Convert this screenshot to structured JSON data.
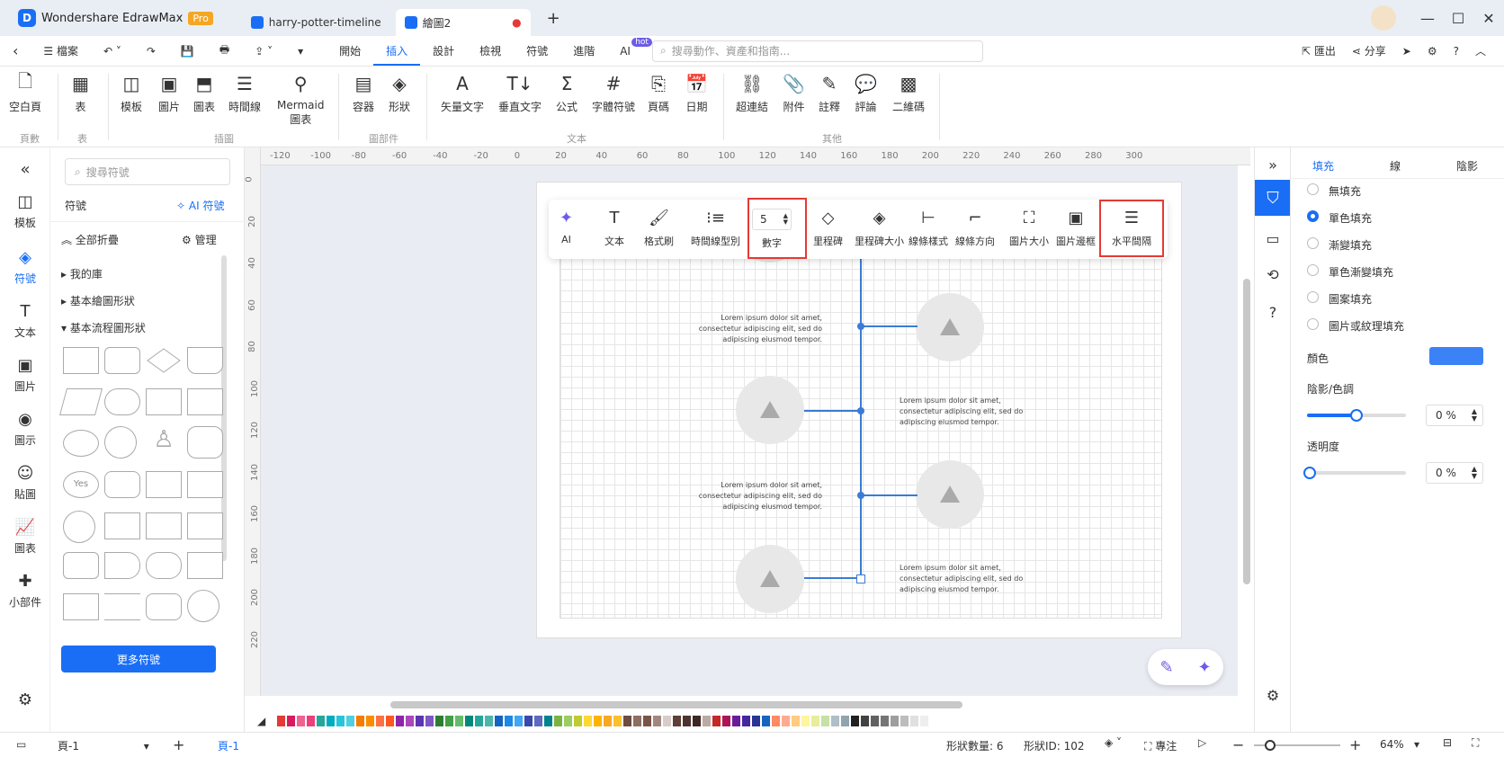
{
  "titlebar": {
    "app_name": "Wondershare EdrawMax",
    "pro_badge": "Pro",
    "tabs": [
      {
        "label": "harry-potter-timeline"
      },
      {
        "label": "繪圖2"
      }
    ],
    "new_tab": "+"
  },
  "menu": {
    "back": "‹",
    "file": "☰ 檔案",
    "items": [
      "開始",
      "插入",
      "設計",
      "檢視",
      "符號",
      "進階",
      "AI"
    ],
    "ai_badge": "hot",
    "search_placeholder": "搜尋動作、資產和指南...",
    "export": "匯出",
    "share": "分享"
  },
  "ribbon": {
    "buttons": [
      {
        "label": "空白頁",
        "icon": "🗋"
      },
      {
        "label": "表",
        "icon": "▦"
      },
      {
        "label": "模板",
        "icon": "◫"
      },
      {
        "label": "圖片",
        "icon": "▣"
      },
      {
        "label": "圖表",
        "icon": "⬒"
      },
      {
        "label": "時間線",
        "icon": "☰"
      },
      {
        "label": "Mermaid\n圖表",
        "icon": "⚲"
      },
      {
        "label": "容器",
        "icon": "▤"
      },
      {
        "label": "形狀",
        "icon": "◈"
      },
      {
        "label": "矢量文字",
        "icon": "A"
      },
      {
        "label": "垂直文字",
        "icon": "T↓"
      },
      {
        "label": "公式",
        "icon": "Σ"
      },
      {
        "label": "字體符號",
        "icon": "#"
      },
      {
        "label": "頁碼",
        "icon": "⎘"
      },
      {
        "label": "日期",
        "icon": "📅"
      },
      {
        "label": "超連結",
        "icon": "⛓"
      },
      {
        "label": "附件",
        "icon": "📎"
      },
      {
        "label": "註釋",
        "icon": "✎"
      },
      {
        "label": "評論",
        "icon": "💬"
      },
      {
        "label": "二維碼",
        "icon": "▩"
      }
    ],
    "groups": [
      "頁數",
      "表",
      "插圖",
      "圖部件",
      "文本",
      "其他"
    ]
  },
  "leftrail": [
    {
      "label": "模板",
      "icon": "◫"
    },
    {
      "label": "符號",
      "icon": "◈"
    },
    {
      "label": "文本",
      "icon": "T"
    },
    {
      "label": "圖片",
      "icon": "▣"
    },
    {
      "label": "圖示",
      "icon": "◉"
    },
    {
      "label": "貼圖",
      "icon": "☺"
    },
    {
      "label": "圖表",
      "icon": "📈"
    },
    {
      "label": "小部件",
      "icon": "✚"
    }
  ],
  "symbols": {
    "search_placeholder": "搜尋符號",
    "title": "符號",
    "ai_symbol": "AI 符號",
    "collapse_all": "全部折疊",
    "manage": "管理",
    "categories": [
      "我的庫",
      "基本繪圖形狀",
      "基本流程圖形狀"
    ],
    "more": "更多符號"
  },
  "ruler_h": [
    "-120",
    "-100",
    "-80",
    "-60",
    "-40",
    "-20",
    "0",
    "20",
    "40",
    "60",
    "80",
    "100",
    "120",
    "140",
    "160",
    "180",
    "200",
    "220",
    "240",
    "260",
    "280",
    "300"
  ],
  "ruler_v": [
    "0",
    "20",
    "40",
    "60",
    "80",
    "100",
    "120",
    "140",
    "160",
    "180",
    "200",
    "220"
  ],
  "context_toolbar": {
    "items": [
      {
        "label": "AI",
        "icon": "✦"
      },
      {
        "label": "文本",
        "icon": "T"
      },
      {
        "label": "格式刷",
        "icon": "🖌"
      },
      {
        "label": "時間線型別",
        "icon": "⁝≡"
      },
      {
        "label": "數字",
        "value": "5"
      },
      {
        "label": "里程碑",
        "icon": "◇"
      },
      {
        "label": "里程碑大小",
        "icon": "◈"
      },
      {
        "label": "線條樣式",
        "icon": "⊢"
      },
      {
        "label": "線條方向",
        "icon": "⌐"
      },
      {
        "label": "圖片大小",
        "icon": "⛶"
      },
      {
        "label": "圖片邊框",
        "icon": "▣"
      },
      {
        "label": "水平間隔",
        "icon": "☰"
      }
    ]
  },
  "timeline": {
    "lorem": "Lorem ipsum dolor sit amet, consectetur adipiscing elit, sed do adipiscing eiusmod tempor."
  },
  "right_tabs": [
    "填充",
    "線",
    "陰影"
  ],
  "fill": {
    "options": [
      "無填充",
      "單色填充",
      "漸變填充",
      "單色漸變填充",
      "圖案填充",
      "圖片或紋理填充"
    ],
    "selected": 1,
    "color_label": "顏色",
    "color": "#3b82f6",
    "shade_label": "陰影/色調",
    "shade_value": "0 %",
    "transparency_label": "透明度",
    "transparency_value": "0 %"
  },
  "status": {
    "page": "頁-1",
    "page_tab": "頁-1",
    "shape_count": "形狀數量: 6",
    "shape_id": "形狀ID: 102",
    "focus": "專注",
    "zoom": "64%"
  },
  "palette": [
    "#e53935",
    "#d81b60",
    "#f06292",
    "#ec407a",
    "#26a69a",
    "#00acc1",
    "#26c6da",
    "#4dd0e1",
    "#f57c00",
    "#fb8c00",
    "#ff7043",
    "#ff5722",
    "#8e24aa",
    "#ab47bc",
    "#5e35b1",
    "#7e57c2",
    "#2e7d32",
    "#43a047",
    "#66bb6a",
    "#00897b",
    "#26a69a",
    "#4db6ac",
    "#1565c0",
    "#1e88e5",
    "#42a5f5",
    "#3949ab",
    "#5c6bc0",
    "#00838f",
    "#7cb342",
    "#9ccc65",
    "#c0ca33",
    "#fdd835",
    "#ffb300",
    "#f9a825",
    "#fbc02d",
    "#6d4c41",
    "#8d6e63",
    "#795548",
    "#a1887f",
    "#d7ccc8",
    "#5d4037",
    "#4e342e",
    "#3e2723",
    "#bcaaa4",
    "#c62828",
    "#ad1457",
    "#6a1b9a",
    "#4527a0",
    "#283593",
    "#1565c0",
    "#ff8a65",
    "#ffab91",
    "#ffcc80",
    "#fff59d",
    "#e6ee9c",
    "#c5e1a5",
    "#b0bec5",
    "#90a4ae",
    "#212121",
    "#424242",
    "#616161",
    "#757575",
    "#9e9e9e",
    "#bdbdbd",
    "#e0e0e0",
    "#eeeeee"
  ]
}
